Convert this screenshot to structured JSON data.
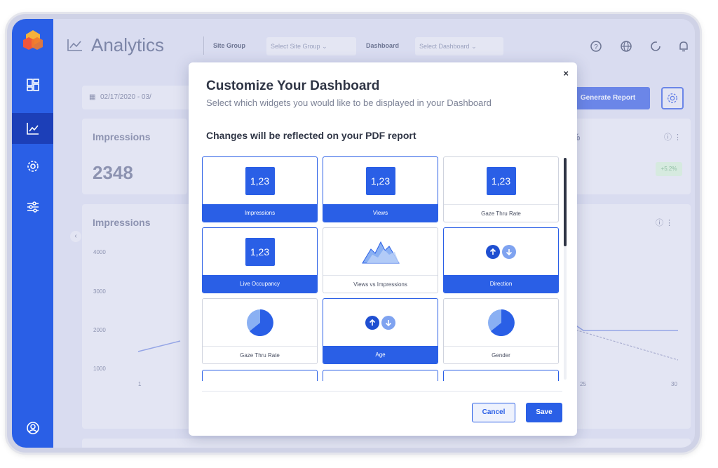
{
  "header": {
    "title": "Analytics",
    "site_group_label": "Site Group",
    "site_group_placeholder": "Select Site Group",
    "dashboard_label": "Dashboard",
    "dashboard_placeholder": "Select Dashboard"
  },
  "background": {
    "date_range": "02/17/2020  -  03/",
    "generate_report": "Generate Report",
    "impressions_card_title": "Impressions",
    "impressions_value": "2348",
    "delta_badge": "+5.2%",
    "percent_fragment": "%",
    "chart_title": "Impressions",
    "y_ticks": [
      "4000",
      "3000",
      "2000",
      "1000"
    ],
    "x_ticks": [
      "1",
      "25",
      "30"
    ]
  },
  "modal": {
    "title": "Customize Your Dashboard",
    "subtitle": "Select which widgets you would like to be displayed in your Dashboard",
    "note": "Changes will be reflected on your PDF report",
    "close": "×",
    "cancel": "Cancel",
    "save": "Save",
    "number_sample": "1,23",
    "tiles": [
      {
        "label": "Impressions",
        "selected": true,
        "visual": "number"
      },
      {
        "label": "Views",
        "selected": true,
        "visual": "number"
      },
      {
        "label": "Gaze Thru Rate",
        "selected": false,
        "visual": "number"
      },
      {
        "label": "Live Occupancy",
        "selected": true,
        "visual": "number"
      },
      {
        "label": "Views vs Impressions",
        "selected": false,
        "visual": "area-chart"
      },
      {
        "label": "Direction",
        "selected": true,
        "visual": "arrows"
      },
      {
        "label": "Gaze Thru Rate",
        "selected": false,
        "visual": "pie-chart"
      },
      {
        "label": "Age",
        "selected": true,
        "visual": "arrows"
      },
      {
        "label": "Gender",
        "selected": false,
        "visual": "pie-chart"
      }
    ]
  },
  "colors": {
    "primary": "#2a5fe6",
    "sidebar_active": "#1c3fb8"
  }
}
